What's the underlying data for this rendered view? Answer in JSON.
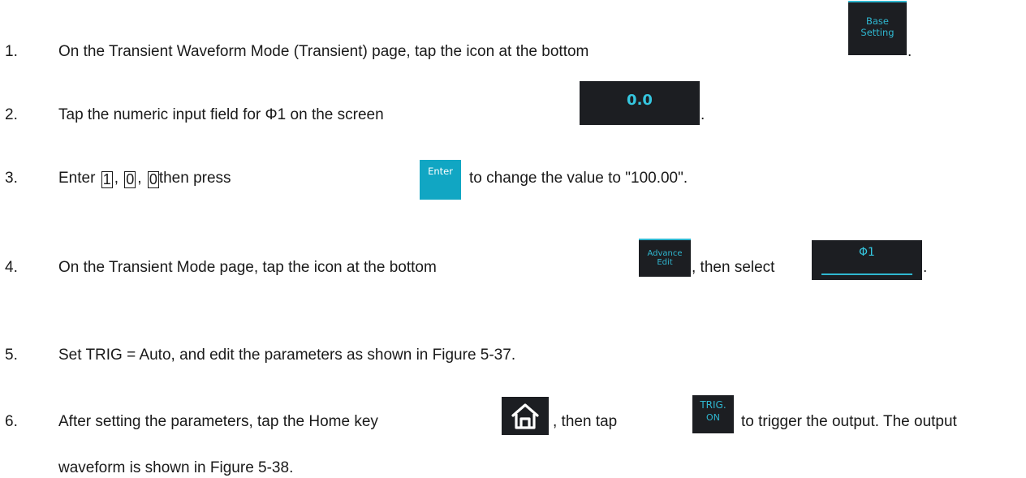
{
  "steps": [
    {
      "num": "1.",
      "text": "On the Transient Waveform Mode (Transient) page, tap the icon at the bottom",
      "end": "."
    },
    {
      "num": "2.",
      "text": "Tap the numeric input field for Φ1 on the screen",
      "end": "."
    },
    {
      "num": "3.",
      "pre": "Enter",
      "key1": "1",
      "sep1": ",",
      "key2": "0",
      "sep2": ",",
      "key3": "0",
      "mid": "then press",
      "post": "to change the value to \"100.00\"."
    },
    {
      "num": "4.",
      "text": "On the Transient Mode page, tap the icon at the bottom",
      "mid": ", then select",
      "end": "."
    },
    {
      "num": "5.",
      "text": "Set TRIG = Auto, and edit the parameters as shown in Figure 5-37."
    },
    {
      "num": "6.",
      "text": "After setting the parameters, tap the Home key",
      "mid": ", then tap",
      "post": "to trigger the output. The output",
      "line2": "waveform is shown in Figure 5-38."
    }
  ],
  "ui": {
    "base_setting": "Base Setting",
    "numeric_field": "0.0",
    "enter": "Enter",
    "advance_edit": "Advance Edit",
    "phi_tab": "Φ1",
    "trig_line1": "TRIG.",
    "trig_line2": "ON",
    "icon_home": "home-icon"
  },
  "colors": {
    "panel_bg": "#1c1e22",
    "accent": "#2fb7d0",
    "enter_bg": "#11a6c3"
  }
}
